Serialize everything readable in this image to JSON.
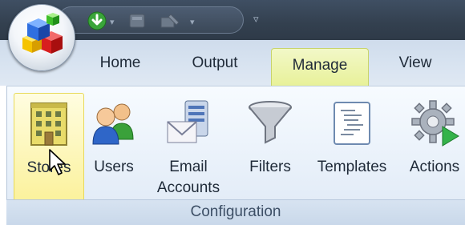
{
  "title_bar": {
    "quick_access": [
      {
        "name": "save-icon"
      },
      {
        "name": "database-icon"
      },
      {
        "name": "tools-icon"
      }
    ],
    "customize_glyph": "▿"
  },
  "tabs": [
    {
      "label": "Home",
      "active": false
    },
    {
      "label": "Output",
      "active": false
    },
    {
      "label": "Manage",
      "active": true
    },
    {
      "label": "View",
      "active": false
    }
  ],
  "ribbon": {
    "buttons": [
      {
        "label": "Stores",
        "label_line2": "",
        "icon": "building-icon",
        "hover": true
      },
      {
        "label": "Users",
        "label_line2": "",
        "icon": "users-icon",
        "hover": false
      },
      {
        "label": "Email",
        "label_line2": "Accounts",
        "icon": "email-accounts-icon",
        "hover": false
      },
      {
        "label": "Filters",
        "label_line2": "",
        "icon": "funnel-icon",
        "hover": false
      },
      {
        "label": "Templates",
        "label_line2": "",
        "icon": "templates-icon",
        "hover": false
      },
      {
        "label": "Actions",
        "label_line2": "",
        "icon": "gear-play-icon",
        "hover": false
      }
    ],
    "group_label": "Configuration"
  },
  "colors": {
    "active_tab": "#e8f19a",
    "title_bar": "#33404f",
    "ribbon": "#e9f1fa"
  }
}
